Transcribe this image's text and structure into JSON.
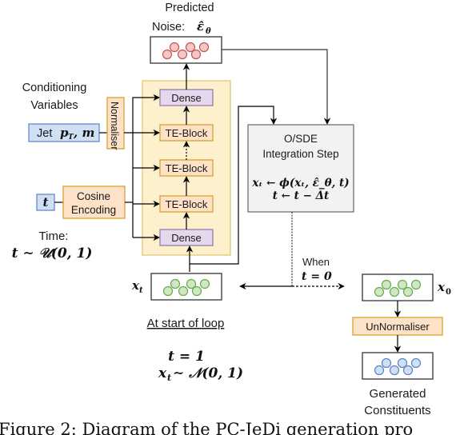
{
  "predicted_noise": {
    "title_line1": "Predicted",
    "title_line2": "Noise: ",
    "symbol": "ε̂",
    "symbol_sub": "θ",
    "particle_color": "#f4c6c6",
    "particle_stroke": "#c25555"
  },
  "conditioning": {
    "title_line1": "Conditioning",
    "title_line2": "Variables",
    "jet_label_prefix": "Jet ",
    "jet_label_math": "p",
    "jet_label_sub": "T",
    "jet_label_suffix": ", m",
    "normaliser": "Normaliser"
  },
  "time": {
    "t_symbol": "t",
    "encoding_line1": "Cosine",
    "encoding_line2": "Encoding",
    "title": "Time:",
    "dist": "t ∼ 𝒰(0, 1)"
  },
  "network": {
    "blocks": [
      "Dense",
      "TE-Block",
      "TE-Block",
      "TE-Block",
      "Dense"
    ]
  },
  "integration": {
    "line1": "O/SDE",
    "line2": "Integration Step",
    "eq1": "xₜ ← ϕ(xₜ, ε̂_θ, t)",
    "eq1_a": "x",
    "eq1_b": "t",
    "eq1_c": " ← ϕ(x",
    "eq1_d": "t",
    "eq1_e": ", ε̂",
    "eq1_f": "θ",
    "eq1_g": ", t)",
    "eq2": "t ← t − Δt"
  },
  "loop": {
    "xt_label": "x",
    "xt_sub": "t",
    "start_label": "At start of loop",
    "init_t": "t = 1",
    "init_x": "x",
    "init_x_sub": "t",
    "init_x_dist": " ∼ 𝒩(0, 1)",
    "when_label": "When",
    "when_cond": "t = 0"
  },
  "output": {
    "x0_label": "x",
    "x0_sub": "0",
    "unnormaliser": "UnNormaliser",
    "generated_line1": "Generated",
    "generated_line2": "Constituents"
  },
  "caption": "Figure 2: Diagram of the PC-JeDi generation pro",
  "colors": {
    "green_fill": "#cfe8c4",
    "green_stroke": "#6aa84f",
    "blue_fill": "#cfe0f5",
    "blue_stroke": "#5b82c0",
    "orange_fill": "#fde2c8",
    "orange_stroke": "#d6a230",
    "purple_fill": "#e4d8ec",
    "purple_stroke": "#9673a6",
    "yellow_bg": "#fdf0cc",
    "grey_fill": "#f2f2f2"
  }
}
